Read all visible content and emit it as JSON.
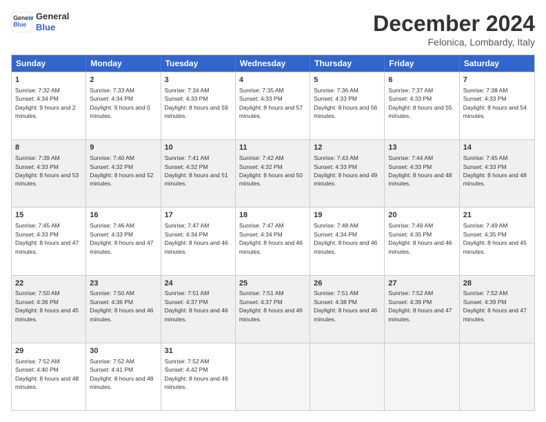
{
  "logo": {
    "line1": "General",
    "line2": "Blue"
  },
  "title": "December 2024",
  "subtitle": "Felonica, Lombardy, Italy",
  "weekdays": [
    "Sunday",
    "Monday",
    "Tuesday",
    "Wednesday",
    "Thursday",
    "Friday",
    "Saturday"
  ],
  "weeks": [
    [
      {
        "day": "1",
        "sunrise": "7:32 AM",
        "sunset": "4:34 PM",
        "daylight": "9 hours and 2 minutes."
      },
      {
        "day": "2",
        "sunrise": "7:33 AM",
        "sunset": "4:34 PM",
        "daylight": "9 hours and 0 minutes."
      },
      {
        "day": "3",
        "sunrise": "7:34 AM",
        "sunset": "4:33 PM",
        "daylight": "8 hours and 59 minutes."
      },
      {
        "day": "4",
        "sunrise": "7:35 AM",
        "sunset": "4:33 PM",
        "daylight": "8 hours and 57 minutes."
      },
      {
        "day": "5",
        "sunrise": "7:36 AM",
        "sunset": "4:33 PM",
        "daylight": "8 hours and 56 minutes."
      },
      {
        "day": "6",
        "sunrise": "7:37 AM",
        "sunset": "4:33 PM",
        "daylight": "8 hours and 55 minutes."
      },
      {
        "day": "7",
        "sunrise": "7:38 AM",
        "sunset": "4:33 PM",
        "daylight": "8 hours and 54 minutes."
      }
    ],
    [
      {
        "day": "8",
        "sunrise": "7:39 AM",
        "sunset": "4:33 PM",
        "daylight": "8 hours and 53 minutes."
      },
      {
        "day": "9",
        "sunrise": "7:40 AM",
        "sunset": "4:32 PM",
        "daylight": "8 hours and 52 minutes."
      },
      {
        "day": "10",
        "sunrise": "7:41 AM",
        "sunset": "4:32 PM",
        "daylight": "8 hours and 51 minutes."
      },
      {
        "day": "11",
        "sunrise": "7:42 AM",
        "sunset": "4:32 PM",
        "daylight": "8 hours and 50 minutes."
      },
      {
        "day": "12",
        "sunrise": "7:43 AM",
        "sunset": "4:33 PM",
        "daylight": "8 hours and 49 minutes."
      },
      {
        "day": "13",
        "sunrise": "7:44 AM",
        "sunset": "4:33 PM",
        "daylight": "8 hours and 48 minutes."
      },
      {
        "day": "14",
        "sunrise": "7:45 AM",
        "sunset": "4:33 PM",
        "daylight": "8 hours and 48 minutes."
      }
    ],
    [
      {
        "day": "15",
        "sunrise": "7:45 AM",
        "sunset": "4:33 PM",
        "daylight": "8 hours and 47 minutes."
      },
      {
        "day": "16",
        "sunrise": "7:46 AM",
        "sunset": "4:33 PM",
        "daylight": "8 hours and 47 minutes."
      },
      {
        "day": "17",
        "sunrise": "7:47 AM",
        "sunset": "4:34 PM",
        "daylight": "8 hours and 46 minutes."
      },
      {
        "day": "18",
        "sunrise": "7:47 AM",
        "sunset": "4:34 PM",
        "daylight": "8 hours and 46 minutes."
      },
      {
        "day": "19",
        "sunrise": "7:48 AM",
        "sunset": "4:34 PM",
        "daylight": "8 hours and 46 minutes."
      },
      {
        "day": "20",
        "sunrise": "7:49 AM",
        "sunset": "4:35 PM",
        "daylight": "8 hours and 46 minutes."
      },
      {
        "day": "21",
        "sunrise": "7:49 AM",
        "sunset": "4:35 PM",
        "daylight": "8 hours and 45 minutes."
      }
    ],
    [
      {
        "day": "22",
        "sunrise": "7:50 AM",
        "sunset": "4:36 PM",
        "daylight": "8 hours and 45 minutes."
      },
      {
        "day": "23",
        "sunrise": "7:50 AM",
        "sunset": "4:36 PM",
        "daylight": "8 hours and 46 minutes."
      },
      {
        "day": "24",
        "sunrise": "7:51 AM",
        "sunset": "4:37 PM",
        "daylight": "8 hours and 46 minutes."
      },
      {
        "day": "25",
        "sunrise": "7:51 AM",
        "sunset": "4:37 PM",
        "daylight": "8 hours and 46 minutes."
      },
      {
        "day": "26",
        "sunrise": "7:51 AM",
        "sunset": "4:38 PM",
        "daylight": "8 hours and 46 minutes."
      },
      {
        "day": "27",
        "sunrise": "7:52 AM",
        "sunset": "4:39 PM",
        "daylight": "8 hours and 47 minutes."
      },
      {
        "day": "28",
        "sunrise": "7:52 AM",
        "sunset": "4:39 PM",
        "daylight": "8 hours and 47 minutes."
      }
    ],
    [
      {
        "day": "29",
        "sunrise": "7:52 AM",
        "sunset": "4:40 PM",
        "daylight": "8 hours and 48 minutes."
      },
      {
        "day": "30",
        "sunrise": "7:52 AM",
        "sunset": "4:41 PM",
        "daylight": "8 hours and 48 minutes."
      },
      {
        "day": "31",
        "sunrise": "7:52 AM",
        "sunset": "4:42 PM",
        "daylight": "8 hours and 49 minutes."
      },
      null,
      null,
      null,
      null
    ]
  ]
}
